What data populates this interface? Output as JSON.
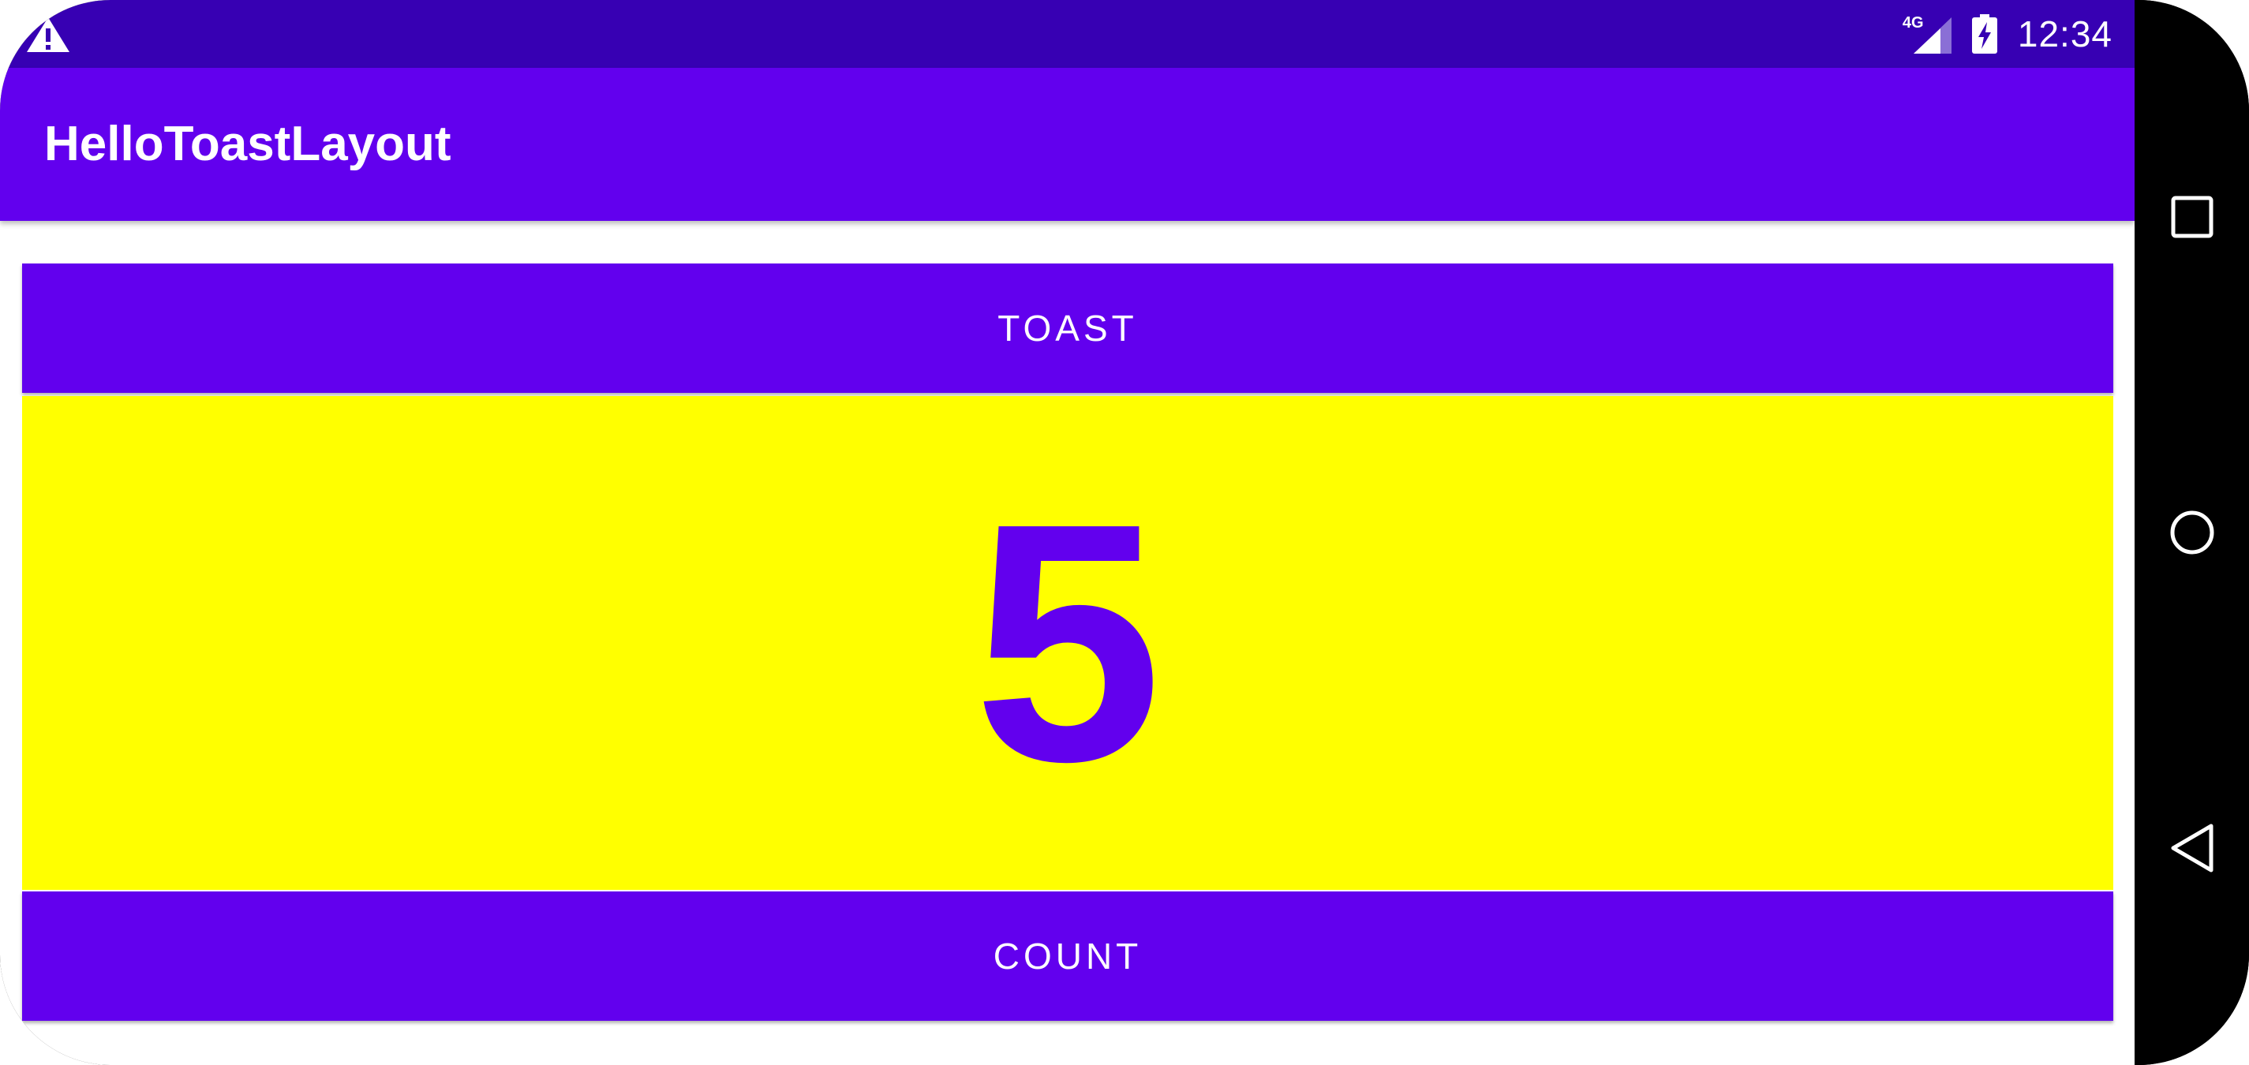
{
  "status_bar": {
    "network": "4G",
    "time": "12:34",
    "icons": [
      "warning-icon",
      "signal-icon",
      "battery-charging-icon"
    ]
  },
  "app_bar": {
    "title": "HelloToastLayout"
  },
  "main": {
    "toast_button_label": "TOAST",
    "count_value": "5",
    "count_button_label": "COUNT"
  },
  "nav_bar": {
    "icons": [
      "recent-apps-icon",
      "home-icon",
      "back-icon"
    ]
  },
  "colors": {
    "status_bar": "#3700b3",
    "primary": "#6200ee",
    "count_background": "#ffff00",
    "on_primary": "#ffffff"
  }
}
